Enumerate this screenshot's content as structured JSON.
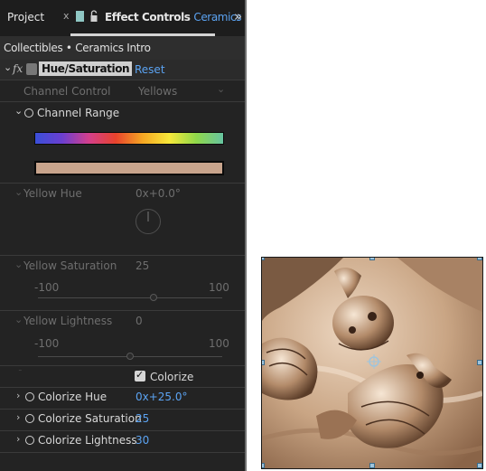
{
  "tabs": {
    "project_label": "Project",
    "close_glyph": "x",
    "effect_controls_label": "Effect Controls",
    "effect_controls_target": "Ceramics Intro",
    "overflow_glyph": "»"
  },
  "breadcrumb": {
    "parent": "Collectibles",
    "separator": "•",
    "child": "Ceramics Intro"
  },
  "effect": {
    "fx_label": "fx",
    "name": "Hue/Saturation",
    "reset_label": "Reset",
    "channel_control_label": "Channel Control",
    "channel_control_value": "Yellows",
    "channel_range_label": "Channel Range",
    "rainbow_colors": [
      "#3a4fd8",
      "#6b3fd0",
      "#d43f8c",
      "#e8432d",
      "#f5a623",
      "#f6e83a",
      "#8fd84a",
      "#66c3a0"
    ],
    "swatch_color": "#c8a48c",
    "yellow_hue_label": "Yellow Hue",
    "yellow_hue_value": "0x+0.0°",
    "yellow_saturation_label": "Yellow Saturation",
    "yellow_saturation_value": "25",
    "yellow_saturation_min": "-100",
    "yellow_saturation_max": "100",
    "yellow_saturation_level": 0.625,
    "yellow_lightness_label": "Yellow Lightness",
    "yellow_lightness_value": "0",
    "yellow_lightness_min": "-100",
    "yellow_lightness_max": "100",
    "yellow_lightness_level": 0.5,
    "colorize_label": "Colorize",
    "colorize_checked": true,
    "colorize_hue_label": "Colorize Hue",
    "colorize_hue_value": "0x+25.0°",
    "colorize_saturation_label": "Colorize Saturation",
    "colorize_saturation_value": "25",
    "colorize_lightness_label": "Colorize Lightness",
    "colorize_lightness_value": "30"
  },
  "glyphs": {
    "chevron_down": "⌄",
    "chevron_right": "›",
    "checkmark": "✓"
  },
  "colors": {
    "accent_blue": "#5ba3f2",
    "tab_accent": "#8fc7c4",
    "sepia_tone": "#b08a6a"
  }
}
